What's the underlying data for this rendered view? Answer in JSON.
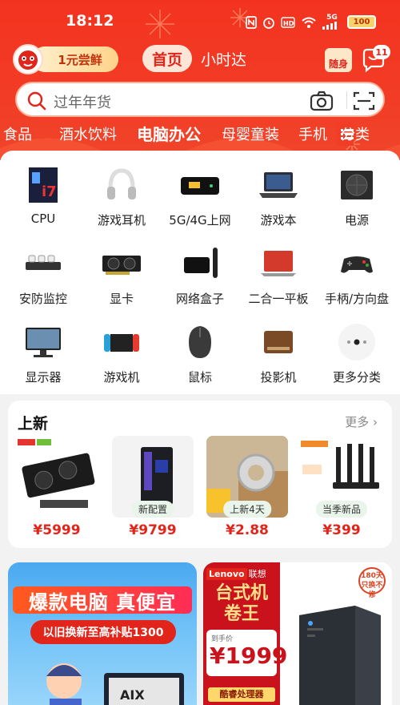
{
  "status_bar": {
    "time": "18:12",
    "battery": "100",
    "network": "5G"
  },
  "top_nav": {
    "trial_label": "1元尝鲜",
    "tabs": [
      {
        "label": "首页"
      },
      {
        "label": "小时达"
      }
    ],
    "suiju_label": "随身",
    "message_badge": "11"
  },
  "search": {
    "placeholder": "过年年货"
  },
  "category_tabs": {
    "items": [
      "食品",
      "酒水饮料",
      "电脑办公",
      "母婴童装",
      "手机"
    ],
    "active": "电脑办公",
    "more_label": "分类"
  },
  "grid": {
    "items": [
      {
        "label": "CPU",
        "icon": "cpu-box-icon"
      },
      {
        "label": "游戏耳机",
        "icon": "headphones-icon"
      },
      {
        "label": "5G/4G上网",
        "icon": "mobile-router-icon"
      },
      {
        "label": "游戏本",
        "icon": "gaming-laptop-icon"
      },
      {
        "label": "电源",
        "icon": "power-supply-icon"
      },
      {
        "label": "安防监控",
        "icon": "security-camera-icon"
      },
      {
        "label": "显卡",
        "icon": "graphics-card-icon"
      },
      {
        "label": "网络盒子",
        "icon": "tv-box-icon"
      },
      {
        "label": "二合一平板",
        "icon": "2in1-tablet-icon"
      },
      {
        "label": "手柄/方向盘",
        "icon": "gamepad-icon"
      },
      {
        "label": "显示器",
        "icon": "monitor-icon"
      },
      {
        "label": "游戏机",
        "icon": "game-console-icon"
      },
      {
        "label": "鼠标",
        "icon": "mouse-icon"
      },
      {
        "label": "投影机",
        "icon": "projector-icon"
      },
      {
        "label": "更多分类",
        "icon": "more-dots-icon"
      }
    ]
  },
  "new_arrivals": {
    "title": "上新",
    "more_label": "更多",
    "products": [
      {
        "price": "¥5999",
        "tag": ""
      },
      {
        "price": "¥9799",
        "tag": "新配置"
      },
      {
        "price": "¥2.88",
        "tag": "上新4天"
      },
      {
        "price": "¥399",
        "tag": "当季新品"
      }
    ]
  },
  "banner_left": {
    "headline": "爆款电脑 真便宜",
    "subline": "以旧换新至高补贴1300"
  },
  "banner_right": {
    "brand": "联想",
    "brand_logo": "Lenovo",
    "title_line1": "台式机",
    "title_line2": "卷王",
    "price_label": "到手价",
    "price": "¥1999",
    "chip": "酷睿处理器",
    "seal": "180天只换不修"
  },
  "colors": {
    "brand_red": "#e1251b",
    "header_red": "#f23b25"
  }
}
